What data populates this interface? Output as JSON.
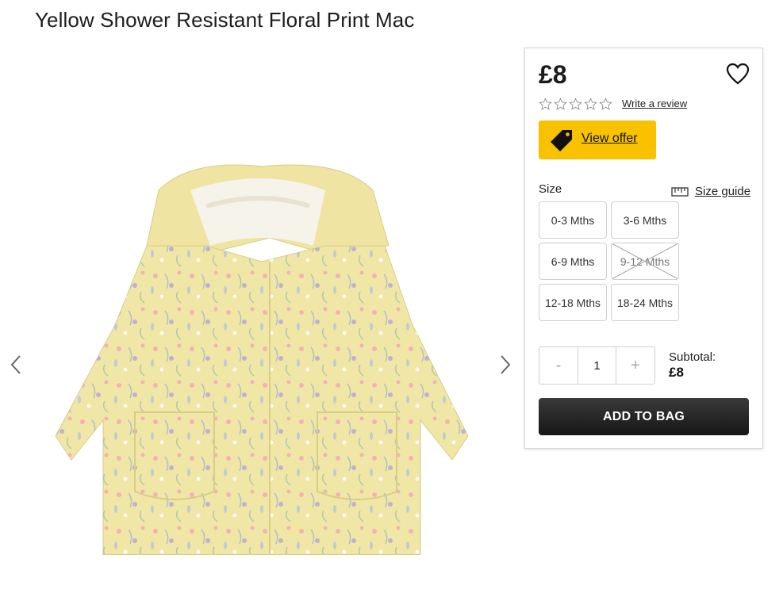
{
  "product": {
    "title": "Yellow Shower Resistant Floral Print Mac",
    "price": "£8",
    "review_link": "Write a review",
    "rating_stars": 0,
    "offer_label": "View offer"
  },
  "gallery": {
    "prev_icon": "chevron-left-icon",
    "next_icon": "chevron-right-icon",
    "image_desc": "coat-image"
  },
  "size_selector": {
    "label": "Size",
    "guide_label": "Size guide",
    "options": [
      {
        "label": "0-3 Mths",
        "available": true
      },
      {
        "label": "3-6 Mths",
        "available": true
      },
      {
        "label": "6-9 Mths",
        "available": true
      },
      {
        "label": "9-12 Mths",
        "available": false
      },
      {
        "label": "12-18 Mths",
        "available": true
      },
      {
        "label": "18-24 Mths",
        "available": true
      }
    ]
  },
  "quantity": {
    "minus": "-",
    "value": "1",
    "plus": "+"
  },
  "subtotal": {
    "label": "Subtotal:",
    "value": "£8"
  },
  "cta": {
    "add_to_bag": "ADD TO BAG"
  },
  "colors": {
    "offer_yellow": "#f8c200",
    "button_dark": "#1f1f1f",
    "coat_yellow": "#f0e6a6"
  }
}
